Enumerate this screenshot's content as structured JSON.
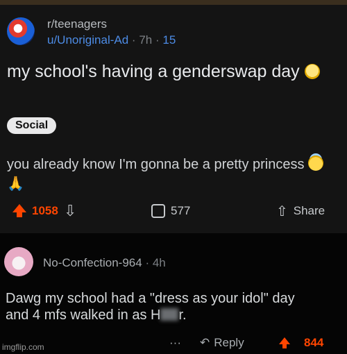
{
  "post": {
    "subreddit": "r/teenagers",
    "author": "u/Unoriginal-Ad",
    "age": "7h",
    "views": "15",
    "separator": "·",
    "title_text": "my school's having a genderswap day",
    "flair": "Social",
    "body": "you already know I'm gonna be a pretty princess",
    "actions": {
      "upvote_count": "1058",
      "comment_count": "577",
      "share_label": "Share"
    }
  },
  "comment": {
    "author": "No-Confection-964",
    "age": "4h",
    "separator": "·",
    "text_before": "Dawg my school had a \"dress as your idol\" day",
    "text_line2_before": "and 4 mfs walked in as H",
    "text_line2_after": "r.",
    "more_label": "···",
    "reply_label": "Reply",
    "score": "844"
  },
  "watermark": "imgflip.com",
  "colors": {
    "accent": "#ff4500",
    "link": "#4d8ce6",
    "background": "#141414"
  }
}
